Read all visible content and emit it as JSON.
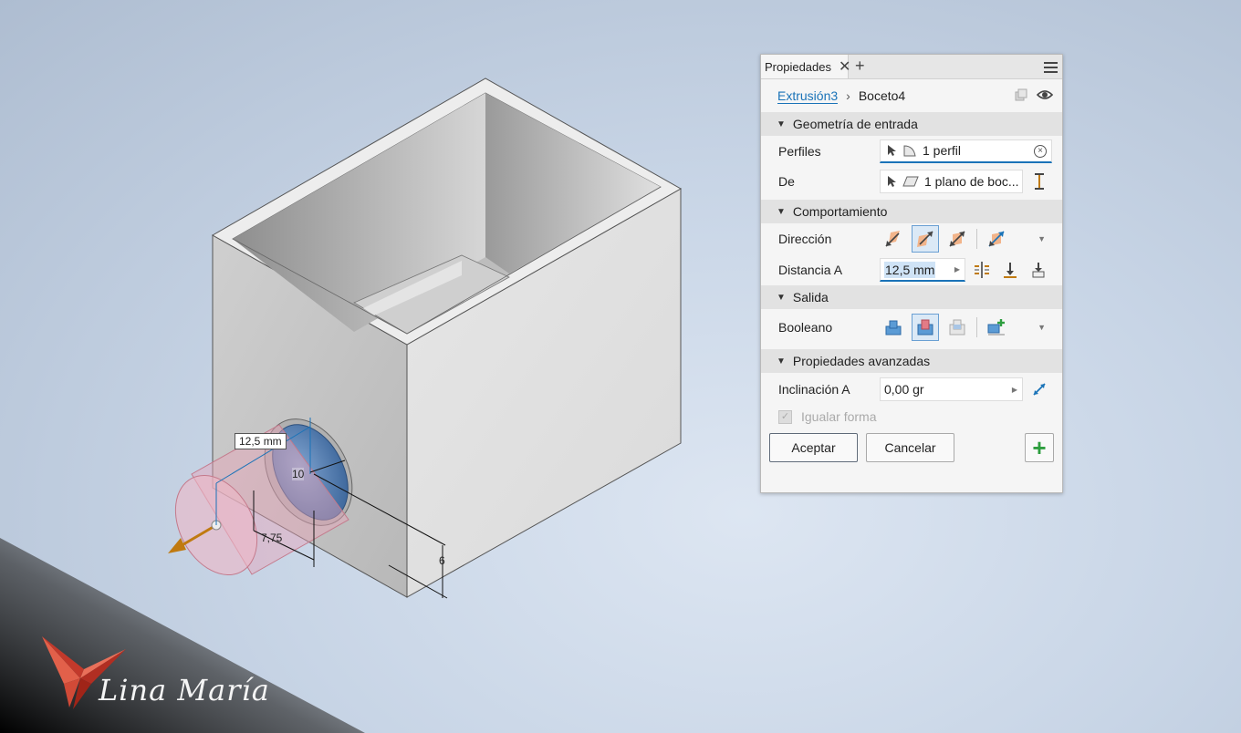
{
  "panel": {
    "tab_label": "Propiedades",
    "tab_close": "✕",
    "tab_add": "+",
    "breadcrumb": {
      "parent": "Extrusión3",
      "separator": "›",
      "current": "Boceto4"
    },
    "sections": {
      "input_geometry": "Geometría de entrada",
      "behavior": "Comportamiento",
      "output": "Salida",
      "advanced": "Propiedades avanzadas"
    },
    "profiles_label": "Perfiles",
    "profiles_value": "1 perfil",
    "from_label": "De",
    "from_value": "1 plano de boc...",
    "direction_label": "Dirección",
    "distance_label": "Distancia A",
    "distance_value": "12,5 mm",
    "boolean_label": "Booleano",
    "taper_label": "Inclinación A",
    "taper_value": "0,00 gr",
    "match_shape_label": "Igualar forma",
    "accept_label": "Aceptar",
    "cancel_label": "Cancelar",
    "add_label": "+"
  },
  "viewport": {
    "dim_distance": "12,5 mm",
    "dim_diameter": "10",
    "dim_offset": "7,75",
    "dim_height": "6"
  },
  "logo": {
    "text": "Lina María"
  },
  "colors": {
    "accent": "#1a73b8",
    "preview_fill": "#e9a5b8",
    "hole_fill": "#4a78b0",
    "arrow": "#c07a10"
  }
}
